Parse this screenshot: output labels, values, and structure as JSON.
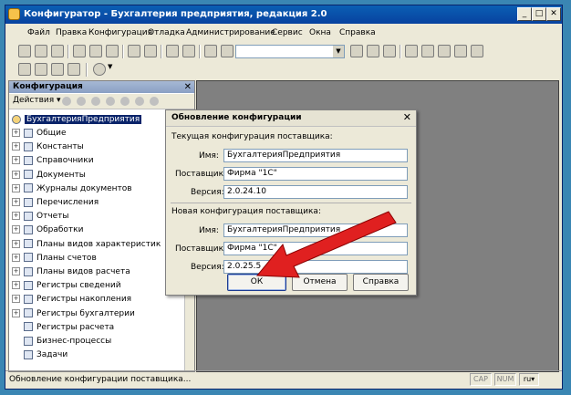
{
  "window": {
    "title": "Конфигуратор - Бухгалтерия предприятия, редакция 2.0"
  },
  "menu": [
    "Файл",
    "Правка",
    "Конфигурация",
    "Отладка",
    "Администрирование",
    "Сервис",
    "Окна",
    "Справка"
  ],
  "panel": {
    "title": "Конфигурация",
    "actions_label": "Действия",
    "tree": {
      "root": "БухгалтерияПредприятия",
      "items": [
        {
          "label": "Общие",
          "expandable": true
        },
        {
          "label": "Константы",
          "expandable": true
        },
        {
          "label": "Справочники",
          "expandable": true
        },
        {
          "label": "Документы",
          "expandable": true
        },
        {
          "label": "Журналы документов",
          "expandable": true
        },
        {
          "label": "Перечисления",
          "expandable": true
        },
        {
          "label": "Отчеты",
          "expandable": true
        },
        {
          "label": "Обработки",
          "expandable": true
        },
        {
          "label": "Планы видов характеристик",
          "expandable": true
        },
        {
          "label": "Планы счетов",
          "expandable": true
        },
        {
          "label": "Планы видов расчета",
          "expandable": true
        },
        {
          "label": "Регистры сведений",
          "expandable": true
        },
        {
          "label": "Регистры накопления",
          "expandable": true
        },
        {
          "label": "Регистры бухгалтерии",
          "expandable": true
        },
        {
          "label": "Регистры расчета",
          "expandable": false
        },
        {
          "label": "Бизнес-процессы",
          "expandable": false
        },
        {
          "label": "Задачи",
          "expandable": false
        }
      ]
    }
  },
  "dialog": {
    "title": "Обновление конфигурации",
    "current_section": "Текущая конфигурация поставщика:",
    "new_section": "Новая конфигурация поставщика:",
    "labels": {
      "name": "Имя:",
      "vendor": "Поставщик:",
      "version": "Версия:"
    },
    "current": {
      "name": "БухгалтерияПредприятия",
      "vendor": "Фирма \"1С\"",
      "version": "2.0.24.10"
    },
    "new": {
      "name": "БухгалтерияПредприятия",
      "vendor": "Фирма \"1С\"",
      "version": "2.0.25.5"
    },
    "buttons": {
      "ok": "ОК",
      "cancel": "Отмена",
      "help": "Справка"
    }
  },
  "status": {
    "text": "Обновление конфигурации поставщика...",
    "indicators": [
      "CAP",
      "NUM",
      "ru"
    ]
  },
  "colors": {
    "arrow": "#e02020",
    "title_bar": "#0a5fb4",
    "selection": "#0a246a"
  }
}
